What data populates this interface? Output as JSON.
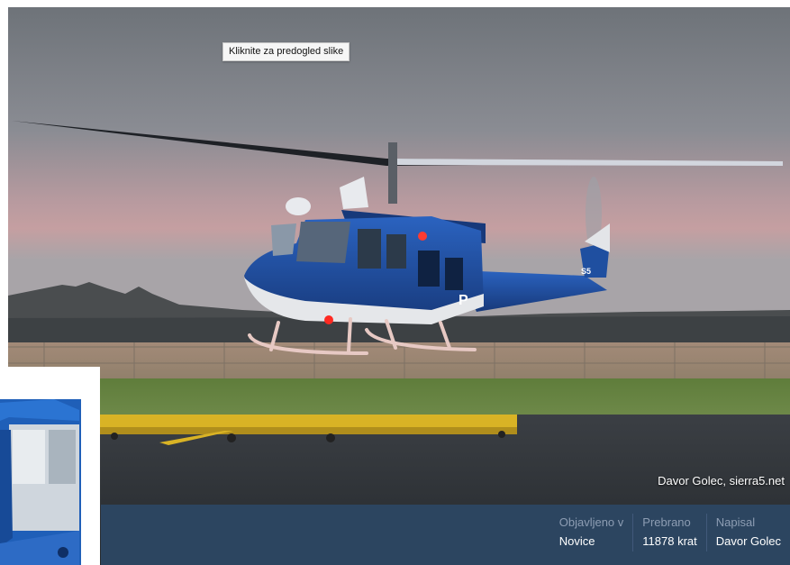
{
  "tooltip": {
    "text": "Kliknite za predogled slike"
  },
  "photo": {
    "credit": "Davor Golec, sierra5.net"
  },
  "meta": {
    "published_label": "Objavljeno v",
    "published_value": "Novice",
    "reads_label": "Prebrano",
    "reads_value": "11878 krat",
    "author_label": "Napisal",
    "author_value": "Davor Golec"
  },
  "colors": {
    "meta_bar": "#2c4560",
    "helicopter_blue": "#1f4fa0",
    "tarmac": "#2e3236"
  }
}
